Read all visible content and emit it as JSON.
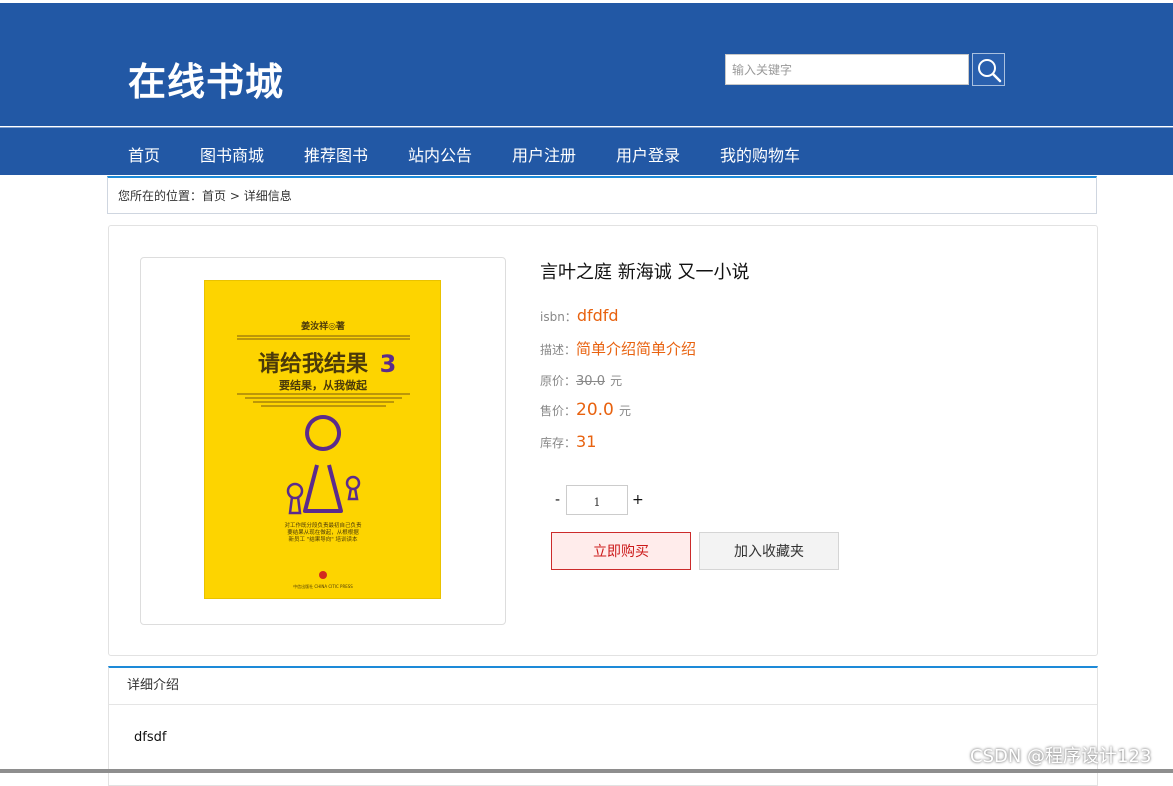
{
  "site": {
    "title": "在线书城"
  },
  "search": {
    "placeholder": "输入关键字"
  },
  "nav": {
    "items": [
      "首页",
      "图书商城",
      "推荐图书",
      "站内公告",
      "用户注册",
      "用户登录",
      "我的购物车"
    ]
  },
  "breadcrumb": {
    "prefix": "您所在的位置：",
    "home": "首页",
    "separator": " > ",
    "current": "详细信息"
  },
  "book": {
    "title": "言叶之庭 新海诚 又一小说",
    "isbn_label": "isbn：",
    "isbn": "dfdfd",
    "desc_label": "描述：",
    "description": "简单介绍简单介绍",
    "orig_price_label": "原价：",
    "orig_price": "30.0",
    "sale_price_label": "售价：",
    "sale_price": "20.0",
    "stock_label": "库存：",
    "stock": "31",
    "currency": "元"
  },
  "cover": {
    "author": "姜汝祥◎著",
    "title": "请给我结果",
    "number": "3",
    "subtitle": "要结果，从我做起",
    "blurb": [
      "对工作既分段负责最初自己负责",
      "要结果从现在做起，从根根据",
      "新员工 \"结果导向\" 培训读本"
    ],
    "publisher": "中信出版社 CHINA CITIC PRESS",
    "colors": {
      "background": "#fdd400",
      "accent": "#5b2b8c"
    }
  },
  "quantity": {
    "minus": "-",
    "plus": "+",
    "value": "1"
  },
  "actions": {
    "buy": "立即购买",
    "favorite": "加入收藏夹"
  },
  "detail": {
    "header": "详细介绍",
    "content": "dfsdf"
  },
  "watermark": "CSDN @程序设计123",
  "colors": {
    "header": "#2258a5",
    "price": "#e8620f",
    "accent_line": "#1d8ad8"
  }
}
